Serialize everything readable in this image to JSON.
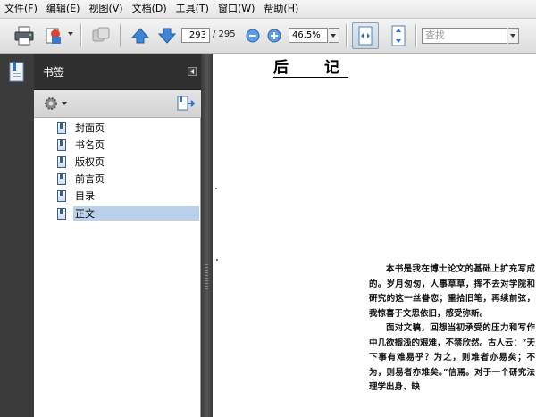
{
  "menu": [
    {
      "label": "文件(F)"
    },
    {
      "label": "编辑(E)"
    },
    {
      "label": "视图(V)"
    },
    {
      "label": "文档(D)"
    },
    {
      "label": "工具(T)"
    },
    {
      "label": "窗口(W)"
    },
    {
      "label": "帮助(H)"
    }
  ],
  "toolbar": {
    "current_page": "293",
    "page_total": "/ 295",
    "zoom": "46.5%",
    "search_placeholder": "查找"
  },
  "bookmarks_panel": {
    "title": "书签",
    "items": [
      {
        "label": "封面页"
      },
      {
        "label": "书名页"
      },
      {
        "label": "版权页"
      },
      {
        "label": "前言页"
      },
      {
        "label": "目录"
      },
      {
        "label": "正文",
        "selected": true
      }
    ]
  },
  "document": {
    "title": "后记",
    "paragraphs": [
      "本书是我在博士论文的基础上扩充写成的。岁月匆匆，人事草草，挥不去对学院和研究的这一丝眷恋；重拾旧笔，再续前弦，我惊喜于文思依旧，感受弥新。",
      "面对文稿，回想当初承受的压力和写作中几欲搁浅的艰难，不禁欣然。古人云：“天下事有难易乎？为之，则难者亦易矣；不为，则易者亦难矣。”信焉。对于一个研究法理学出身、缺"
    ]
  },
  "colors": {
    "panel_dark": "#2f2f2f",
    "selection": "#b9d1ea",
    "accent_blue": "#2f6fc6"
  }
}
